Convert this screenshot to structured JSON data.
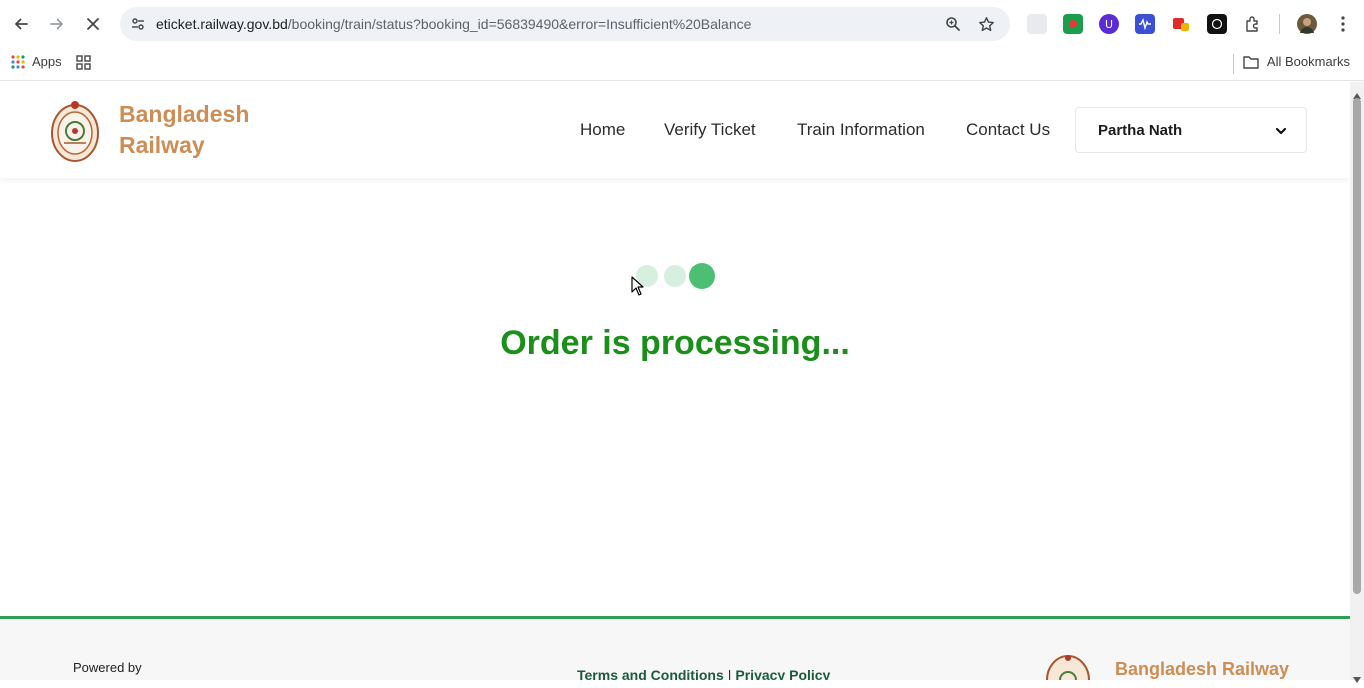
{
  "browser": {
    "url_host": "eticket.railway.gov.bd",
    "url_path": "/booking/train/status?booking_id=56839490&error=Insufficient%20Balance",
    "bookmarks": {
      "apps_label": "Apps",
      "all_bookmarks_label": "All Bookmarks"
    }
  },
  "header": {
    "brand_line1": "Bangladesh",
    "brand_line2": "Railway",
    "nav": {
      "home": "Home",
      "verify_ticket": "Verify Ticket",
      "train_information": "Train Information",
      "contact_us": "Contact Us"
    },
    "user_name": "Partha Nath"
  },
  "main": {
    "status_message": "Order is processing..."
  },
  "footer": {
    "powered_by": "Powered by",
    "terms": "Terms and Conditions",
    "separator": "|",
    "privacy": "Privacy Policy",
    "brand": "Bangladesh Railway"
  },
  "colors": {
    "brand_orange": "#cd8d55",
    "status_green": "#1a8f1a",
    "footer_border_green": "#2f9e5a",
    "loader_dot_active": "#4cbf75",
    "loader_dot_faded": "#d6efdf"
  }
}
